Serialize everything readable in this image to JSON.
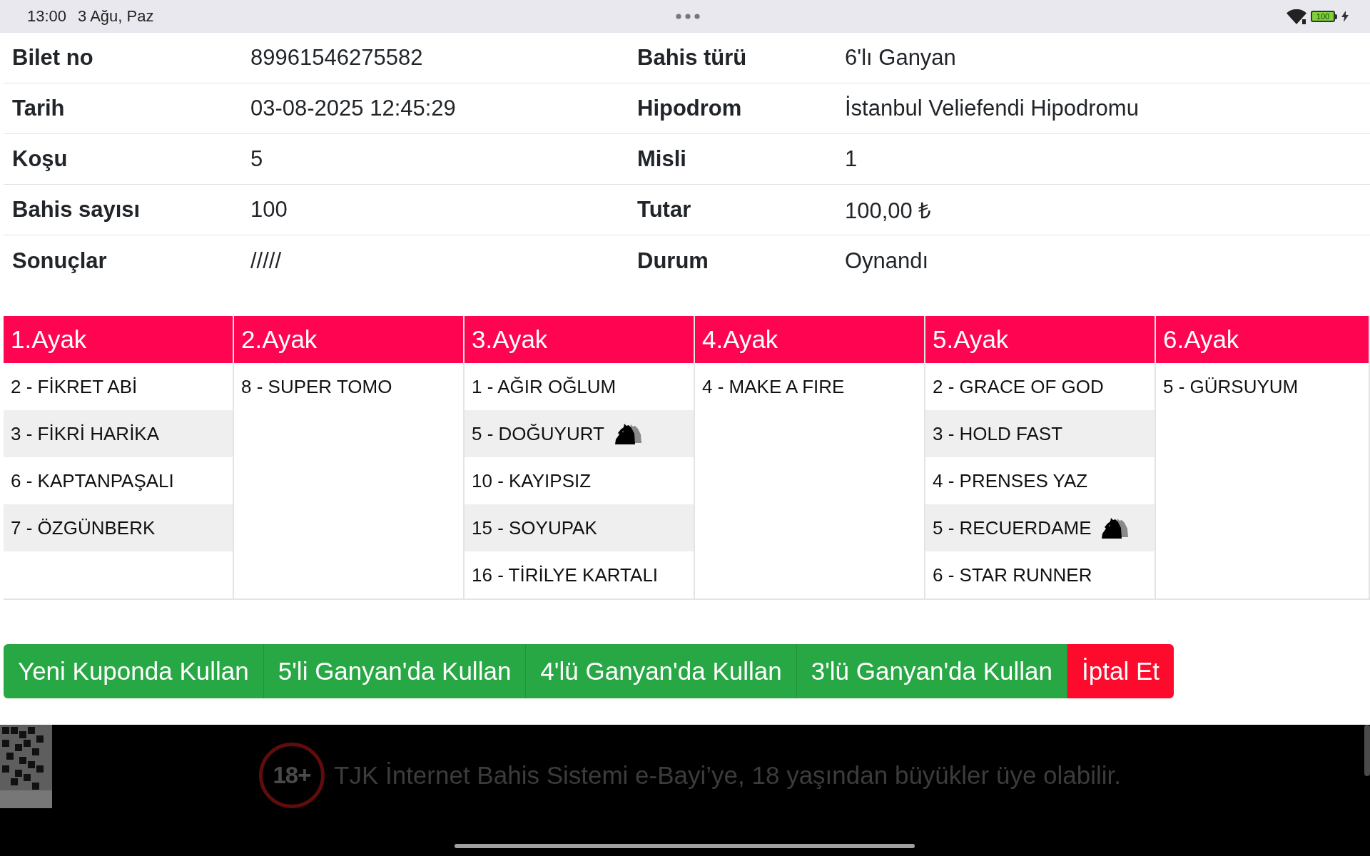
{
  "status_bar": {
    "time": "13:00",
    "date": "3 Ağu, Paz",
    "battery": "100"
  },
  "details": {
    "rows": [
      {
        "cells": [
          {
            "label": "Bilet no",
            "value": "89961546275582"
          },
          {
            "label": "Bahis türü",
            "value": "6'lı Ganyan"
          }
        ]
      },
      {
        "cells": [
          {
            "label": "Tarih",
            "value": "03-08-2025 12:45:29"
          },
          {
            "label": "Hipodrom",
            "value": "İstanbul Veliefendi Hipodromu"
          }
        ]
      },
      {
        "cells": [
          {
            "label": "Koşu",
            "value": "5"
          },
          {
            "label": "Misli",
            "value": "1"
          }
        ]
      },
      {
        "cells": [
          {
            "label": "Bahis sayısı",
            "value": "100"
          },
          {
            "label": "Tutar",
            "value": "100,00 ₺"
          }
        ]
      },
      {
        "cells": [
          {
            "label": "Sonuçlar",
            "value": "/////"
          },
          {
            "label": "Durum",
            "value": "Oynandı"
          }
        ]
      }
    ]
  },
  "legs": [
    {
      "title": "1.Ayak",
      "horses": [
        {
          "name": "2 - FİKRET ABİ",
          "coupled": false
        },
        {
          "name": "3 - FİKRİ HARİKA",
          "coupled": false
        },
        {
          "name": "6 - KAPTANPAŞALI",
          "coupled": false
        },
        {
          "name": "7 - ÖZGÜNBERK",
          "coupled": false
        }
      ]
    },
    {
      "title": "2.Ayak",
      "horses": [
        {
          "name": "8 - SUPER TOMO",
          "coupled": false
        }
      ]
    },
    {
      "title": "3.Ayak",
      "horses": [
        {
          "name": "1 - AĞIR OĞLUM",
          "coupled": false
        },
        {
          "name": "5 - DOĞUYURT",
          "coupled": true
        },
        {
          "name": "10 - KAYIPSIZ",
          "coupled": false
        },
        {
          "name": "15 - SOYUPAK",
          "coupled": false
        },
        {
          "name": "16 - TİRİLYE KARTALI",
          "coupled": false
        }
      ]
    },
    {
      "title": "4.Ayak",
      "horses": [
        {
          "name": "4 - MAKE A FIRE",
          "coupled": false
        }
      ]
    },
    {
      "title": "5.Ayak",
      "horses": [
        {
          "name": "2 - GRACE OF GOD",
          "coupled": false
        },
        {
          "name": "3 - HOLD FAST",
          "coupled": false
        },
        {
          "name": "4 - PRENSES YAZ",
          "coupled": false
        },
        {
          "name": "5 - RECUERDAME",
          "coupled": true
        },
        {
          "name": "6 - STAR RUNNER",
          "coupled": false
        }
      ]
    },
    {
      "title": "6.Ayak",
      "horses": [
        {
          "name": "5 - GÜRSUYUM",
          "coupled": false
        }
      ]
    }
  ],
  "actions": [
    {
      "label": "Yeni Kuponda Kullan",
      "kind": "primary"
    },
    {
      "label": "5'li Ganyan'da Kullan",
      "kind": "primary"
    },
    {
      "label": "4'lü Ganyan'da Kullan",
      "kind": "primary"
    },
    {
      "label": "3'lü Ganyan'da Kullan",
      "kind": "primary"
    },
    {
      "label": "İptal Et",
      "kind": "danger"
    }
  ],
  "footer": {
    "badge": "18+",
    "notice": "TJK İnternet Bahis Sistemi e-Bayi’ye, 18 yaşından büyükler üye olabilir."
  }
}
